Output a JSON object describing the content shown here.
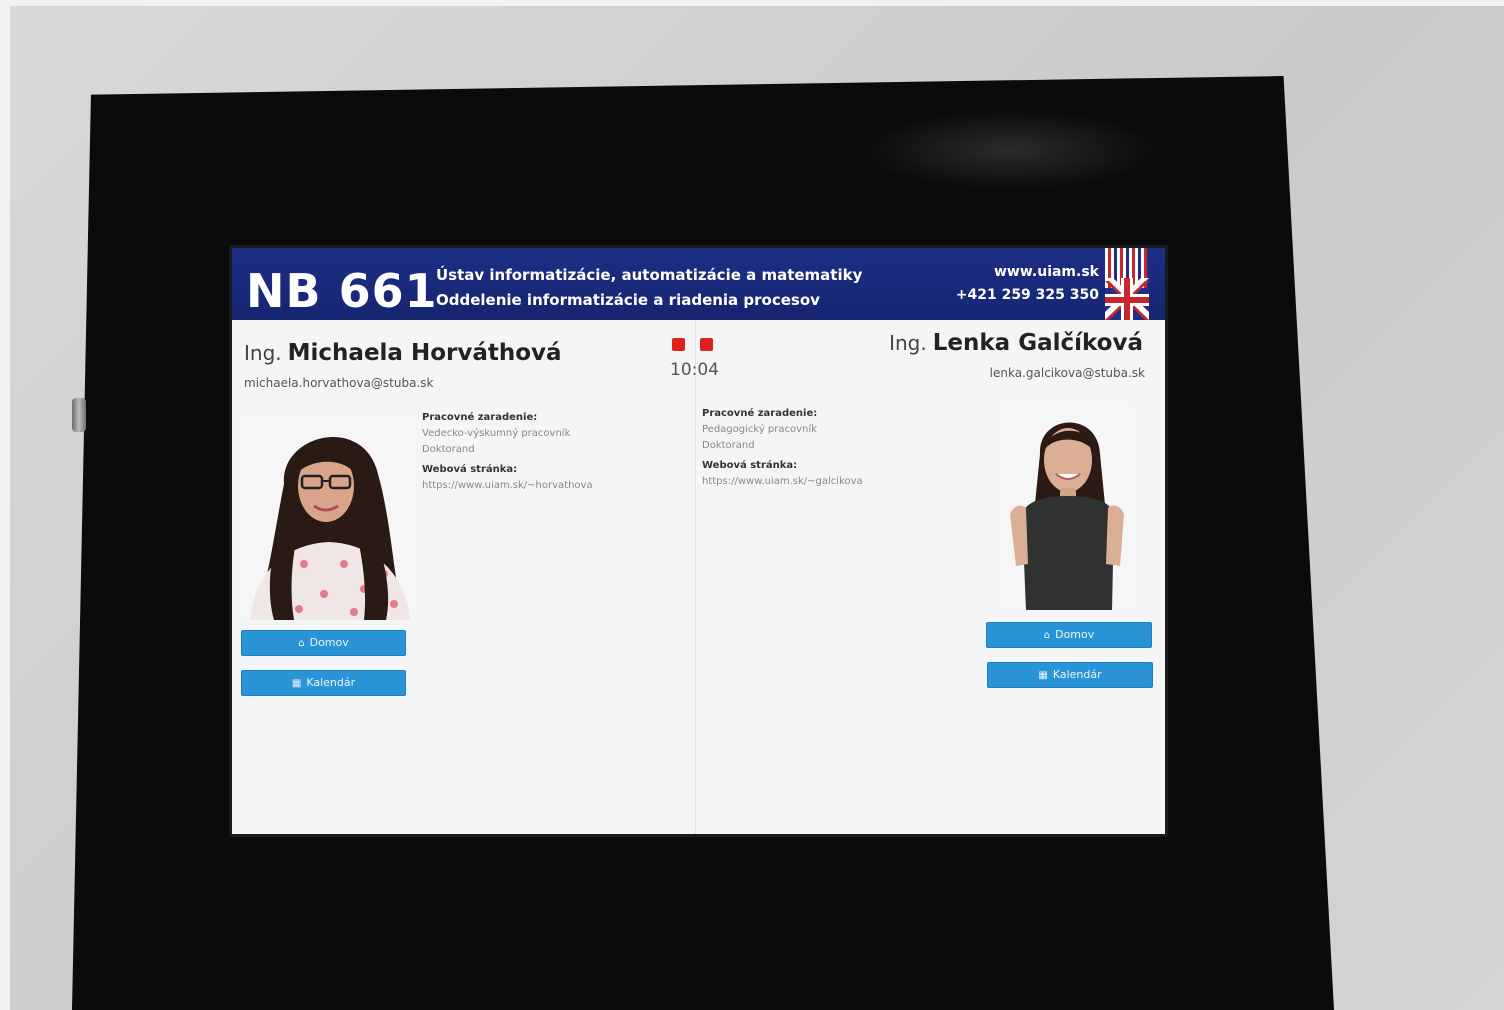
{
  "header": {
    "room": "NB 661",
    "institute_line1": "Ústav informatizácie, automatizácie a matematiky",
    "institute_line2": "Oddelenie informatizácie a riadenia procesov",
    "website": "www.uiam.sk",
    "phone": "+421 259 325 350",
    "language_flag_icon": "uk-flag-icon"
  },
  "status": {
    "time": "10:04",
    "indicator_color": "#e0201c"
  },
  "left_person": {
    "title": "Ing.",
    "name": "Michaela Horváthová",
    "email": "michaela.horvathova@stuba.sk",
    "position_label": "Pracovné zaradenie:",
    "position_line1": "Vedecko-výskumný pracovník",
    "position_line2": "Doktorand",
    "website_label": "Webová stránka:",
    "website_url": "https://www.uiam.sk/~horvathova",
    "home_button": "Domov",
    "calendar_button": "Kalendár"
  },
  "right_person": {
    "title": "Ing.",
    "name": "Lenka Galčíková",
    "email": "lenka.galcikova@stuba.sk",
    "position_label": "Pracovné zaradenie:",
    "position_line1": "Pedagogický pracovník",
    "position_line2": "Doktorand",
    "website_label": "Webová stránka:",
    "website_url": "https://www.uiam.sk/~galcikova",
    "home_button": "Domov",
    "calendar_button": "Kalendár"
  },
  "colors": {
    "header_bg": "#1a2b7a",
    "button_bg": "#2a95d6",
    "frame": "#0b0b0c"
  }
}
